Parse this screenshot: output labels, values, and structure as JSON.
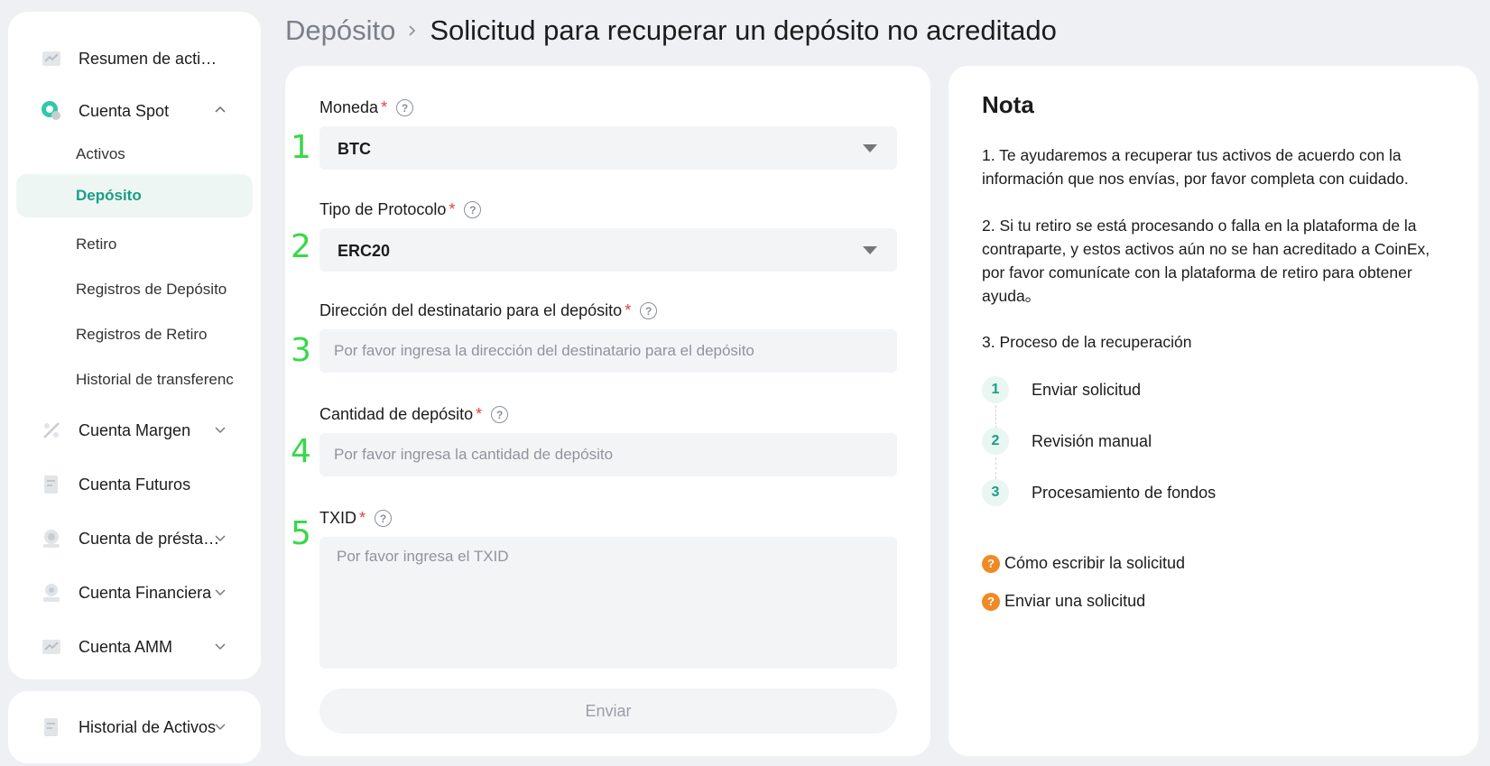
{
  "sidebar": {
    "items": [
      {
        "label": "Resumen de activos",
        "icon": "chart-icon"
      },
      {
        "label": "Cuenta Spot",
        "icon": "spot-icon"
      },
      {
        "label": "Cuenta Margen",
        "icon": "margin-icon"
      },
      {
        "label": "Cuenta Futuros",
        "icon": "futures-icon"
      },
      {
        "label": "Cuenta de préstamos",
        "icon": "loan-icon"
      },
      {
        "label": "Cuenta Financiera",
        "icon": "finance-icon"
      },
      {
        "label": "Cuenta AMM",
        "icon": "amm-icon"
      }
    ],
    "sub_items": [
      {
        "label": "Activos"
      },
      {
        "label": "Depósito"
      },
      {
        "label": "Retiro"
      },
      {
        "label": "Registros de Depósito"
      },
      {
        "label": "Registros de Retiro"
      },
      {
        "label": "Historial de transferencias"
      }
    ],
    "bottom": {
      "label": "Historial de Activos",
      "icon": "history-icon"
    },
    "active_color": "#1a9e86"
  },
  "header": {
    "parent": "Depósito",
    "title": "Solicitud para recuperar un depósito no acreditado"
  },
  "form": {
    "coin": {
      "label": "Moneda",
      "value": "BTC",
      "step": "1"
    },
    "protocol": {
      "label": "Tipo de Protocolo",
      "value": "ERC20",
      "step": "2"
    },
    "address": {
      "label": "Dirección del destinatario para el depósito",
      "placeholder": "Por favor ingresa la dirección del destinatario para el depósito",
      "step": "3"
    },
    "amount": {
      "label": "Cantidad de depósito",
      "placeholder": "Por favor ingresa la cantidad de depósito",
      "step": "4"
    },
    "txid": {
      "label": "TXID",
      "placeholder": "Por favor ingresa el TXID",
      "step": "5"
    },
    "required_mark": "*",
    "help_mark": "?",
    "submit_label": "Enviar"
  },
  "note": {
    "title": "Nota",
    "p1": "1. Te ayudaremos a recuperar tus activos de acuerdo con la información que nos envías, por favor completa con cuidado.",
    "p2": "2. Si tu retiro se está procesando o falla en la plataforma de la contraparte, y estos activos aún no se han acreditado a CoinEx, por favor comunícate con la plataforma de retiro para obtener ayuda。",
    "p3": "3. Proceso de la recuperación",
    "steps": [
      {
        "num": "1",
        "label": "Enviar solicitud"
      },
      {
        "num": "2",
        "label": "Revisión manual"
      },
      {
        "num": "3",
        "label": "Procesamiento de fondos"
      }
    ],
    "links": [
      {
        "label": "Cómo escribir la solicitud"
      },
      {
        "label": "Enviar una solicitud"
      }
    ],
    "link_icon_color": "#f08a24"
  }
}
